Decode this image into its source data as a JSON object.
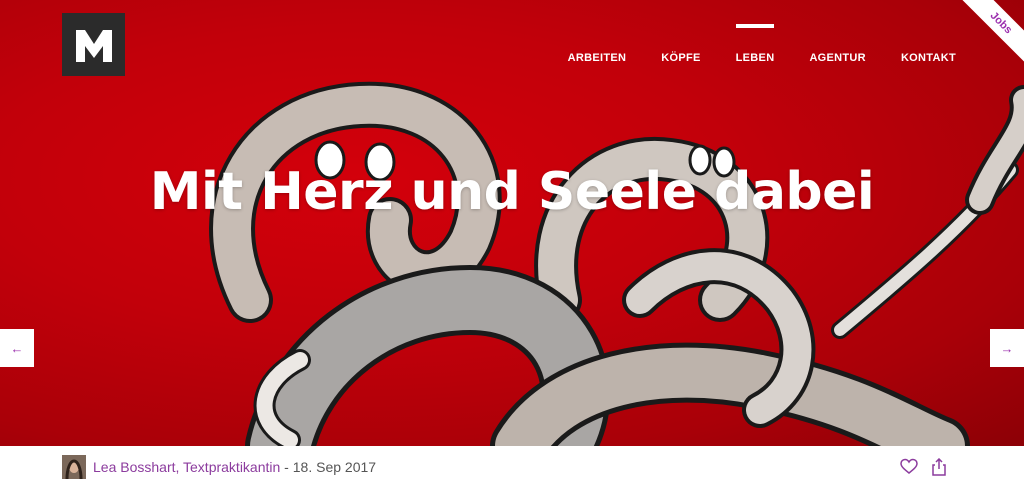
{
  "header": {
    "logo_letter": "M",
    "nav": [
      "ARBEITEN",
      "KÖPFE",
      "LEBEN",
      "AGENTUR",
      "KONTAKT"
    ],
    "active_nav": "LEBEN",
    "jobs_label": "Jobs"
  },
  "hero": {
    "title": "Mit Herz und Seele dabei",
    "prev_label": "←",
    "next_label": "→"
  },
  "post": {
    "author": "Lea Bosshart, Textpraktikantin",
    "separator": " - ",
    "date": "18. Sep 2017"
  },
  "icons": {
    "like": "heart-icon",
    "share": "share-icon"
  },
  "colors": {
    "accent": "#8c3c9e",
    "hero_red": "#c2000a",
    "logo_bg": "#2b2b2b"
  }
}
